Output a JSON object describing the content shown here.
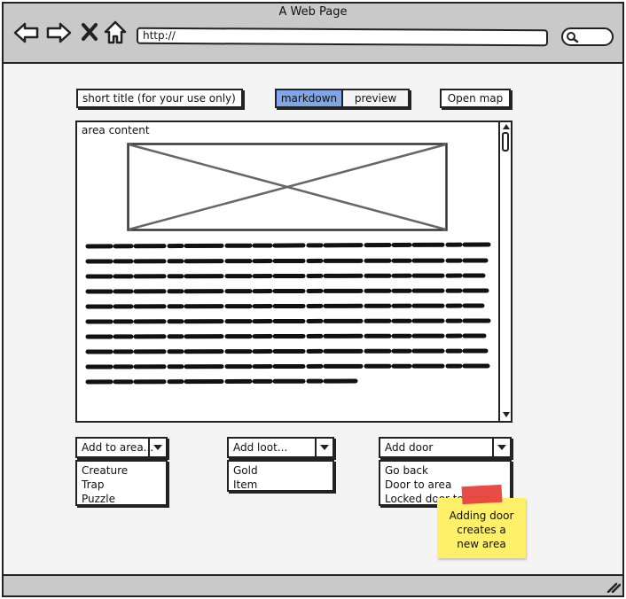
{
  "browser": {
    "title": "A Web Page",
    "url": "http://"
  },
  "toolbar": {
    "short_title_value": "short title (for your use only)",
    "markdown_label": "markdown",
    "preview_label": "preview",
    "open_map_label": "Open map"
  },
  "editor": {
    "label": "area content"
  },
  "dropdowns": {
    "add_to_area": {
      "label": "Add to area...",
      "options": [
        "Creature",
        "Trap",
        "Puzzle"
      ]
    },
    "add_loot": {
      "label": "Add loot...",
      "options": [
        "Gold",
        "Item"
      ]
    },
    "add_door": {
      "label": "Add door",
      "options": [
        "Go back",
        "Door to area",
        "Locked door to area"
      ]
    }
  },
  "note": {
    "lines": [
      "Adding door",
      "creates a",
      "new area"
    ]
  },
  "colors": {
    "selected_segment": "#7fa6e6",
    "sticky_note": "#fff06a",
    "tape": "#e8413c"
  }
}
